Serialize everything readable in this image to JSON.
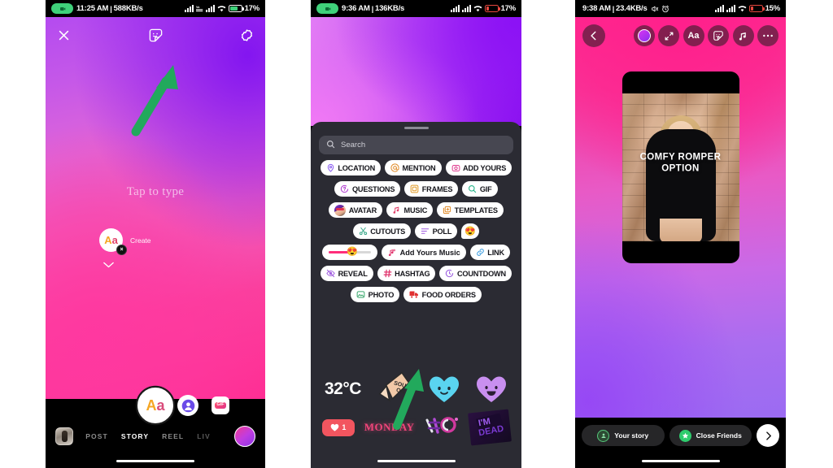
{
  "panels": {
    "left": {
      "status_bar": {
        "recording_icon": "screen-record-icon",
        "time": "11:25 AM",
        "separator": "|",
        "network_speed": "588KB/s",
        "signal_1": "signal-bars-icon",
        "volte": "volte-icon",
        "signal_2": "signal-bars-icon",
        "wifi": "wifi-icon",
        "battery_icon": "battery-charging-icon",
        "battery_pct": "17%"
      },
      "topbar": {
        "close": "close-icon",
        "sticker": "sticker-icon",
        "settings": "gear-icon"
      },
      "canvas": {
        "placeholder": "Tap to type",
        "create_label": "Create",
        "create_glyph_a": "A",
        "create_glyph_b": "a",
        "create_remove": "×",
        "chevron": "chevron-down-icon"
      },
      "tools": {
        "text_tool": "Aa",
        "text_tool_a": "A",
        "text_tool_b": "a",
        "avatar_tool": "avatar-icon",
        "gif_tool": "GIF"
      },
      "nav": {
        "thumbnail": "gallery-thumbnail",
        "modes": [
          {
            "label": "POST",
            "state": "inactive"
          },
          {
            "label": "STORY",
            "state": "active"
          },
          {
            "label": "REEL",
            "state": "inactive"
          },
          {
            "label": "LIV",
            "state": "faded"
          }
        ],
        "camera_flip": "camera-switch-icon"
      }
    },
    "middle": {
      "status_bar": {
        "recording_icon": "screen-record-icon",
        "time": "9:36 AM",
        "separator": "|",
        "network_speed": "136KB/s",
        "signal_1": "signal-bars-icon",
        "signal_2": "signal-bars-icon",
        "wifi": "wifi-icon",
        "battery_icon": "battery-low-icon",
        "battery_pct": "17%"
      },
      "tray": {
        "grabber": "drag-handle",
        "search": {
          "icon": "search-icon",
          "placeholder": "Search",
          "value": ""
        },
        "rows": [
          [
            {
              "label": "LOCATION",
              "icon": "location-pin-icon",
              "color": "#8a5cf0"
            },
            {
              "label": "MENTION",
              "icon": "at-mention-icon",
              "color": "#e08a28"
            },
            {
              "label": "ADD YOURS",
              "icon": "add-yours-camera-icon",
              "color": "#e03a8e"
            }
          ],
          [
            {
              "label": "QUESTIONS",
              "icon": "question-bubble-icon",
              "color": "#b03ad0"
            },
            {
              "label": "FRAMES",
              "icon": "frame-square-icon",
              "color": "#e09a28"
            },
            {
              "label": "GIF",
              "icon": "gif-search-icon",
              "color": "#27b58a"
            }
          ],
          [
            {
              "label": "AVATAR",
              "icon": "avatar-face-icon",
              "color": "#8d3ad6"
            },
            {
              "label": "MUSIC",
              "icon": "music-note-icon",
              "color": "#e0406a"
            },
            {
              "label": "TEMPLATES",
              "icon": "templates-icon",
              "color": "#e08a28"
            }
          ],
          [
            {
              "label": "CUTOUTS",
              "icon": "scissors-icon",
              "color": "#3aa88a"
            },
            {
              "label": "POLL",
              "icon": "poll-bars-icon",
              "color": "#a05ce0"
            },
            {
              "label": "",
              "icon": "emoji-slider-bubble",
              "color": "#f5b73d",
              "emoji": "😍"
            }
          ],
          [
            {
              "label": "",
              "icon": "emoji-slider-icon",
              "color": "#ff2d7a",
              "emoji": "😍"
            },
            {
              "label": "Add Yours Music",
              "icon": "add-yours-music-icon",
              "color": "#e0306a"
            },
            {
              "label": "LINK",
              "icon": "link-chain-icon",
              "color": "#3a9ce0"
            }
          ],
          [
            {
              "label": "REVEAL",
              "icon": "reveal-eye-icon",
              "color": "#a05ce0"
            },
            {
              "label": "HASHTAG",
              "icon": "hashtag-icon",
              "color": "#e0306a"
            },
            {
              "label": "COUNTDOWN",
              "icon": "countdown-clock-icon",
              "color": "#9b5ce0"
            }
          ],
          [
            {
              "label": "PHOTO",
              "icon": "photo-icon",
              "color": "#3aa86e"
            },
            {
              "label": "FOOD ORDERS",
              "icon": "food-truck-icon",
              "color": "#e03030"
            }
          ]
        ],
        "sticker_rows": [
          [
            {
              "name": "temperature-sticker",
              "text": "32°C"
            },
            {
              "name": "sound-on-sticker",
              "text": "SOUND ON"
            },
            {
              "name": "blue-heart-sticker",
              "text": ""
            },
            {
              "name": "purple-heart-sticker",
              "text": ""
            }
          ],
          [
            {
              "name": "like-count-sticker",
              "text": "1"
            },
            {
              "name": "monday-sticker",
              "text": "MONDAY"
            },
            {
              "name": "hashtag-art-sticker",
              "text": "#"
            },
            {
              "name": "im-dead-sticker",
              "text": "I'M DEAD"
            }
          ]
        ]
      }
    },
    "right": {
      "status_bar": {
        "time": "9:38 AM",
        "separator": "|",
        "network_speed": "23.4KB/s",
        "mute": "mute-icon",
        "alarm": "alarm-icon",
        "signal_1": "signal-bars-icon",
        "signal_2": "signal-bars-icon",
        "wifi": "wifi-icon",
        "battery_icon": "battery-low-icon",
        "battery_pct": "15%"
      },
      "topbar": {
        "back": "chevron-left-icon",
        "tools": [
          {
            "name": "color-picker-tool",
            "icon": "gradient-circle-icon"
          },
          {
            "name": "crop-tool",
            "icon": "expand-corners-icon"
          },
          {
            "name": "text-tool",
            "icon": "Aa"
          },
          {
            "name": "sticker-tool",
            "icon": "sticker-icon"
          },
          {
            "name": "music-tool",
            "icon": "music-note-icon"
          },
          {
            "name": "more-tool",
            "icon": "more-dots-icon"
          }
        ]
      },
      "media": {
        "caption_line1": "COMFY ROMPER",
        "caption_line2": "OPTION"
      },
      "footer": {
        "your_story_label": "Your story",
        "your_story_icon": "your-story-avatar-icon",
        "close_friends_label": "Close Friends",
        "close_friends_icon": "close-friends-star-icon",
        "send_icon": "chevron-right-icon"
      }
    }
  },
  "annotations": {
    "arrow_color": "#22a95c",
    "left_arrow": "points-to-sticker-button",
    "middle_arrow": "points-to-photo-chip"
  }
}
